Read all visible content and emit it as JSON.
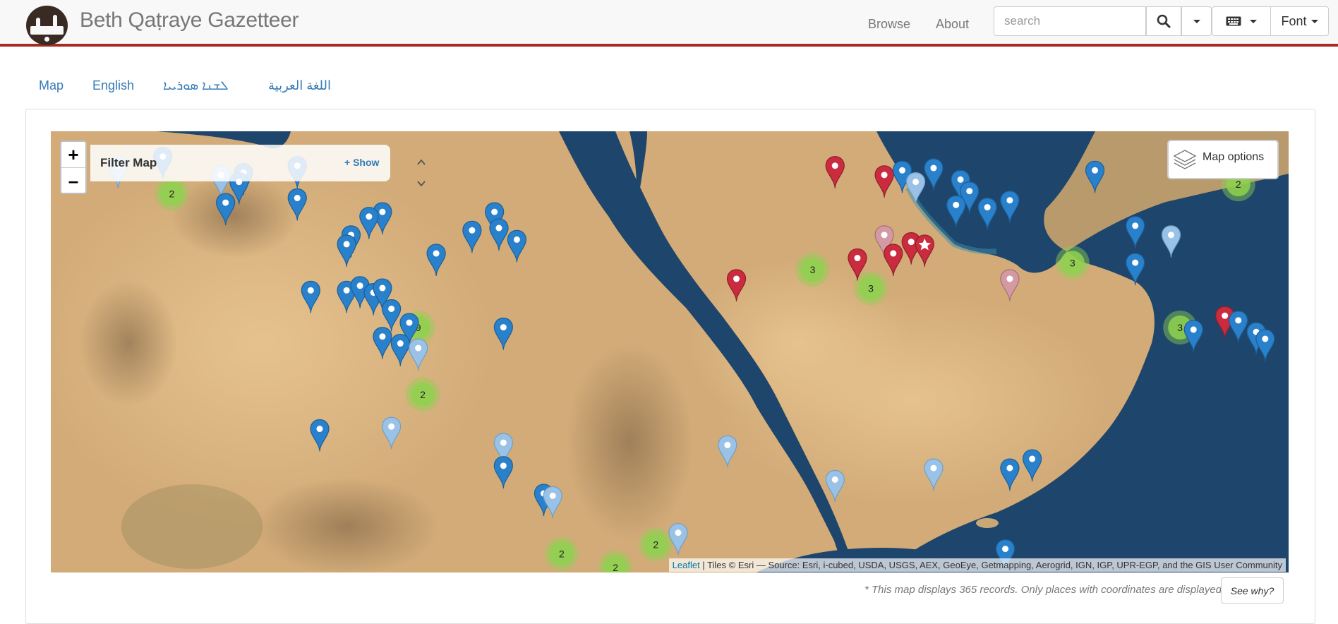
{
  "header": {
    "brand": "Beth Qaṭraye Gazetteer",
    "nav": [
      {
        "label": "Browse"
      },
      {
        "label": "About"
      }
    ],
    "search_placeholder": "search",
    "font_label": "Font",
    "icons": {
      "search": "search-icon",
      "keyboard": "keyboard-icon",
      "caret": "caret-down-icon"
    }
  },
  "tabs": [
    {
      "label": "Map"
    },
    {
      "label": "English"
    },
    {
      "label": "ܠܫܢܐ ܣܘܪܝܝܐ"
    },
    {
      "label": "اللغة العربية"
    }
  ],
  "map": {
    "zoom_in": "+",
    "zoom_out": "–",
    "filter_title": "Filter Map",
    "filter_show": "+ Show",
    "options_label": "Map options",
    "attribution_link": "Leaflet",
    "attribution_text": " | Tiles © Esri — Source: Esri, i-cubed, USDA, USGS, AEX, GeoEye, Getmapping, Aerogrid, IGN, IGP, UPR-EGP, and the GIS User Community",
    "colors": {
      "blue": "#2a81cb",
      "light_blue": "#9ac2e6",
      "red": "#cb2b3e",
      "pink": "#d49aa3",
      "cluster": "#8ed14f",
      "sea": "#1e456b",
      "land": "#d9b27e"
    },
    "clusters": [
      {
        "count": "2",
        "lng": 34.8,
        "lat": 29.8
      },
      {
        "count": "2",
        "lng": 58.6,
        "lat": 30.2
      },
      {
        "count": "3",
        "lng": 49.1,
        "lat": 26.5
      },
      {
        "count": "3",
        "lng": 50.4,
        "lat": 25.7
      },
      {
        "count": "3",
        "lng": 54.9,
        "lat": 26.8
      },
      {
        "count": "3",
        "lng": 57.3,
        "lat": 24.0
      },
      {
        "count": "9",
        "lng": 40.3,
        "lat": 24.0
      },
      {
        "count": "2",
        "lng": 40.4,
        "lat": 21.1
      },
      {
        "count": "2",
        "lng": 43.5,
        "lat": 14.2
      },
      {
        "count": "2",
        "lng": 45.6,
        "lat": 14.6
      },
      {
        "count": "2",
        "lng": 44.7,
        "lat": 13.6
      }
    ],
    "markers": [
      {
        "style": "light",
        "lng": 33.6,
        "lat": 30.0
      },
      {
        "style": "blue",
        "lng": 34.6,
        "lat": 30.4
      },
      {
        "style": "light",
        "lng": 35.9,
        "lat": 29.6
      },
      {
        "style": "blue",
        "lng": 36.4,
        "lat": 29.7
      },
      {
        "style": "blue",
        "lng": 36.3,
        "lat": 29.3
      },
      {
        "style": "blue",
        "lng": 37.6,
        "lat": 30.0
      },
      {
        "style": "blue",
        "lng": 36.0,
        "lat": 28.4
      },
      {
        "style": "blue",
        "lng": 37.6,
        "lat": 28.6
      },
      {
        "style": "blue",
        "lng": 39.5,
        "lat": 28.0
      },
      {
        "style": "blue",
        "lng": 39.2,
        "lat": 27.8
      },
      {
        "style": "blue",
        "lng": 38.8,
        "lat": 27.0
      },
      {
        "style": "blue",
        "lng": 38.7,
        "lat": 26.6
      },
      {
        "style": "blue",
        "lng": 42.0,
        "lat": 28.0
      },
      {
        "style": "blue",
        "lng": 41.5,
        "lat": 27.2
      },
      {
        "style": "blue",
        "lng": 42.1,
        "lat": 27.3
      },
      {
        "style": "blue",
        "lng": 42.5,
        "lat": 26.8
      },
      {
        "style": "blue",
        "lng": 40.7,
        "lat": 26.2
      },
      {
        "style": "blue",
        "lng": 37.9,
        "lat": 24.6
      },
      {
        "style": "blue",
        "lng": 38.7,
        "lat": 24.6
      },
      {
        "style": "blue",
        "lng": 39.0,
        "lat": 24.8
      },
      {
        "style": "blue",
        "lng": 39.3,
        "lat": 24.5
      },
      {
        "style": "blue",
        "lng": 39.5,
        "lat": 24.7
      },
      {
        "style": "blue",
        "lng": 39.7,
        "lat": 23.8
      },
      {
        "style": "blue",
        "lng": 40.1,
        "lat": 23.2
      },
      {
        "style": "blue",
        "lng": 39.5,
        "lat": 22.6
      },
      {
        "style": "blue",
        "lng": 39.9,
        "lat": 22.3
      },
      {
        "style": "light",
        "lng": 40.3,
        "lat": 22.1
      },
      {
        "style": "blue",
        "lng": 42.2,
        "lat": 23.0
      },
      {
        "style": "blue",
        "lng": 38.1,
        "lat": 18.6
      },
      {
        "style": "light",
        "lng": 39.7,
        "lat": 18.7
      },
      {
        "style": "light",
        "lng": 42.2,
        "lat": 18.0
      },
      {
        "style": "blue",
        "lng": 42.2,
        "lat": 17.0
      },
      {
        "style": "blue",
        "lng": 43.1,
        "lat": 15.8
      },
      {
        "style": "light",
        "lng": 43.3,
        "lat": 15.7
      },
      {
        "style": "light",
        "lng": 47.2,
        "lat": 17.9
      },
      {
        "style": "light",
        "lng": 49.6,
        "lat": 16.4
      },
      {
        "style": "light",
        "lng": 51.8,
        "lat": 16.9
      },
      {
        "style": "blue",
        "lng": 53.5,
        "lat": 16.9
      },
      {
        "style": "blue",
        "lng": 54.0,
        "lat": 17.3
      },
      {
        "style": "light",
        "lng": 46.1,
        "lat": 14.1
      },
      {
        "style": "blue",
        "lng": 53.4,
        "lat": 13.4
      },
      {
        "style": "red",
        "lng": 47.4,
        "lat": 25.1
      },
      {
        "style": "red",
        "lng": 49.6,
        "lat": 30.0
      },
      {
        "style": "red",
        "lng": 50.7,
        "lat": 29.6
      },
      {
        "style": "blue",
        "lng": 51.1,
        "lat": 29.8
      },
      {
        "style": "light",
        "lng": 51.4,
        "lat": 29.3
      },
      {
        "style": "blue",
        "lng": 51.8,
        "lat": 29.9
      },
      {
        "style": "blue",
        "lng": 52.4,
        "lat": 29.4
      },
      {
        "style": "blue",
        "lng": 52.6,
        "lat": 28.9
      },
      {
        "style": "blue",
        "lng": 52.3,
        "lat": 28.3
      },
      {
        "style": "blue",
        "lng": 53.0,
        "lat": 28.2
      },
      {
        "style": "blue",
        "lng": 53.5,
        "lat": 28.5
      },
      {
        "style": "blue",
        "lng": 55.4,
        "lat": 29.8
      },
      {
        "style": "pink",
        "lng": 50.7,
        "lat": 27.0
      },
      {
        "style": "red",
        "lng": 51.3,
        "lat": 26.7
      },
      {
        "style": "red",
        "lng": 50.1,
        "lat": 26.0
      },
      {
        "style": "red",
        "lng": 50.9,
        "lat": 26.2
      },
      {
        "style": "star",
        "lng": 51.6,
        "lat": 26.6
      },
      {
        "style": "pink",
        "lng": 53.5,
        "lat": 25.1
      },
      {
        "style": "blue",
        "lng": 56.3,
        "lat": 27.4
      },
      {
        "style": "light",
        "lng": 57.1,
        "lat": 27.0
      },
      {
        "style": "blue",
        "lng": 60.8,
        "lat": 27.6
      },
      {
        "style": "light",
        "lng": 65.0,
        "lat": 26.8
      },
      {
        "style": "blue",
        "lng": 56.3,
        "lat": 25.8
      },
      {
        "style": "red",
        "lng": 58.3,
        "lat": 23.5
      },
      {
        "style": "blue",
        "lng": 58.6,
        "lat": 23.3
      },
      {
        "style": "blue",
        "lng": 59.0,
        "lat": 22.8
      },
      {
        "style": "blue",
        "lng": 59.2,
        "lat": 22.5
      },
      {
        "style": "blue",
        "lng": 57.6,
        "lat": 22.9
      }
    ]
  },
  "footer_note": "* This map displays 365 records. Only places with coordinates are displayed.",
  "see_why": "See why?"
}
